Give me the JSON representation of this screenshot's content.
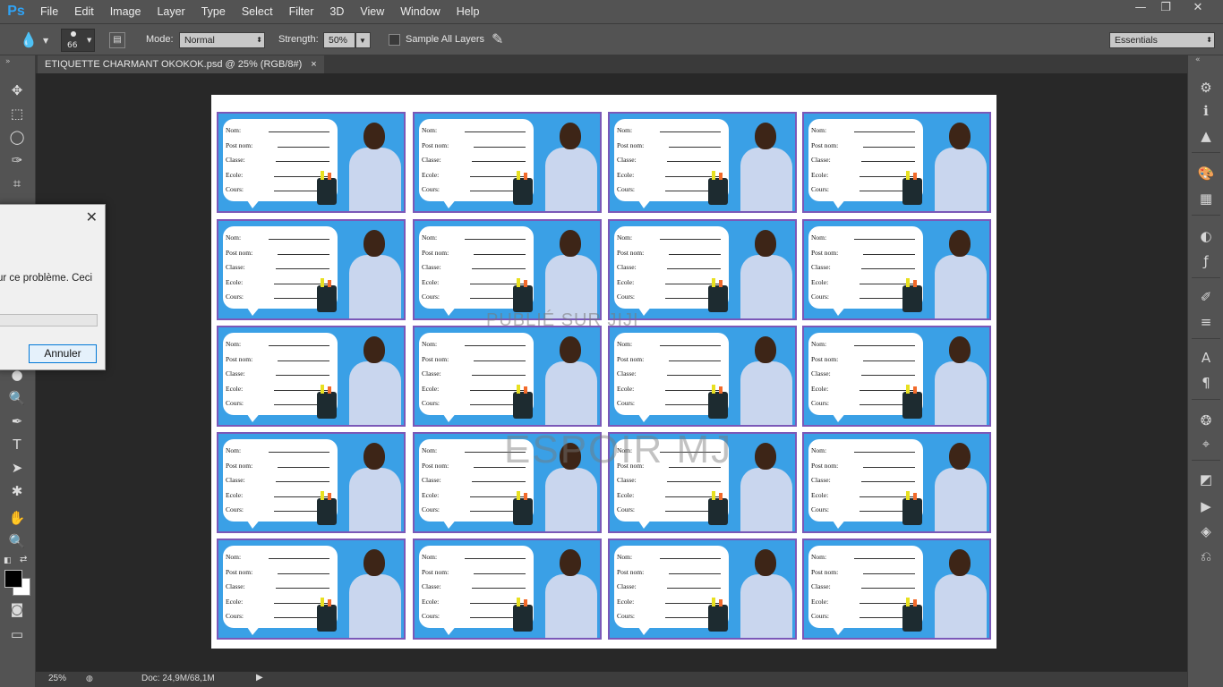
{
  "app": {
    "logo": "Ps"
  },
  "menu": [
    "File",
    "Edit",
    "Image",
    "Layer",
    "Type",
    "Select",
    "Filter",
    "3D",
    "View",
    "Window",
    "Help"
  ],
  "window_controls": {
    "minimize": "—",
    "restore": "❐",
    "close": "✕"
  },
  "options": {
    "brush_size": "66",
    "mode_label": "Mode:",
    "mode_value": "Normal",
    "strength_label": "Strength:",
    "strength_value": "50%",
    "sample_all_layers": "Sample All Layers",
    "workspace": "Essentials"
  },
  "document_tab": {
    "title": "ETIQUETTE CHARMANT OKOKOK.psd @ 25% (RGB/8#)",
    "close": "×"
  },
  "label_fields": [
    "Nom:",
    "Post nom:",
    "Classe:",
    "Ecole:",
    "Cours:"
  ],
  "watermark": {
    "line1": "PUBLIÉ SUR JIJI",
    "line2": "ESPOIR MJ"
  },
  "status": {
    "zoom": "25%",
    "doc": "Doc: 24,9M/68,1M"
  },
  "dialog": {
    "message": "ur ce problème. Ceci",
    "cancel": "Annuler",
    "close": "✕"
  },
  "colors": {
    "panel": "#535353",
    "canvas_bg": "#282828",
    "label_bg": "#3aa0e6",
    "label_border": "#7b58b8",
    "ps_blue": "#2fa3f6"
  }
}
